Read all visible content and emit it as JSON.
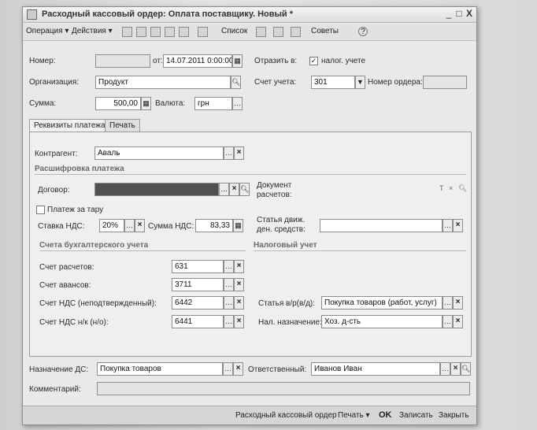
{
  "window": {
    "title": "Расходный кассовый ордер: Оплата поставщику. Новый *",
    "controls": {
      "minimize": "_",
      "maximize": "□",
      "close": "X"
    }
  },
  "toolbar": {
    "operation": "Операция ▾",
    "actions": "Действия ▾",
    "list": "Список",
    "tips": "Советы",
    "help": "?"
  },
  "header": {
    "number_label": "Номер:",
    "number_value": "",
    "date_label": "от:",
    "date_value": "14.07.2011 0:00:00",
    "reflect_label": "Отразить в:",
    "tax_check_label": "налог. учете",
    "tax_checked": "✓",
    "org_label": "Организация:",
    "org_value": "Продукт",
    "account_label": "Счет учета:",
    "account_value": "301",
    "order_num_label": "Номер ордера:",
    "order_num_value": "",
    "sum_label": "Сумма:",
    "sum_value": "500,00",
    "currency_label": "Валюта:",
    "currency_value": "грн"
  },
  "tabs": [
    {
      "label": "Реквизиты платежа"
    },
    {
      "label": "Печать"
    }
  ],
  "payment": {
    "counterparty_label": "Контрагент:",
    "counterparty_value": "Аваль",
    "breakdown_title": "Расшифровка платежа",
    "contract_label": "Договор:",
    "contract_value": "",
    "settlement_doc_label": "Документ расчетов:",
    "tare_label": "Платеж за тару",
    "vat_rate_label": "Ставка НДС:",
    "vat_rate_value": "20%",
    "vat_sum_label": "Сумма НДС:",
    "vat_sum_value": "83,33",
    "cashflow_label": "Статья движ. ден. средств:",
    "cashflow_value": "",
    "accounting_title": "Счета бухгалтерского учета",
    "tax_title": "Налоговый учет",
    "settle_acc_label": "Счет расчетов:",
    "settle_acc_value": "631",
    "advance_acc_label": "Счет авансов:",
    "advance_acc_value": "3711",
    "vat_unconf_label": "Счет НДС (неподтвержденный):",
    "vat_unconf_value": "6442",
    "vat_nk_label": "Счет НДС н/к (н/о):",
    "vat_nk_value": "6441",
    "expense_item_label": "Статья в/р(в/д):",
    "expense_item_value": "Покупка товаров (работ, услуг)",
    "tax_purpose_label": "Нал. назначение:",
    "tax_purpose_value": "Хоз. д-сть"
  },
  "footer": {
    "purpose_label": "Назначение ДС:",
    "purpose_value": "Покупка товаров",
    "responsible_label": "Ответственный:",
    "responsible_value": "Иванов Иван",
    "comment_label": "Комментарий:",
    "comment_value": ""
  },
  "statusbar": {
    "doc_type": "Расходный кассовый ордер",
    "print": "Печать ▾",
    "ok": "OK",
    "save": "Записать",
    "close": "Закрыть"
  }
}
